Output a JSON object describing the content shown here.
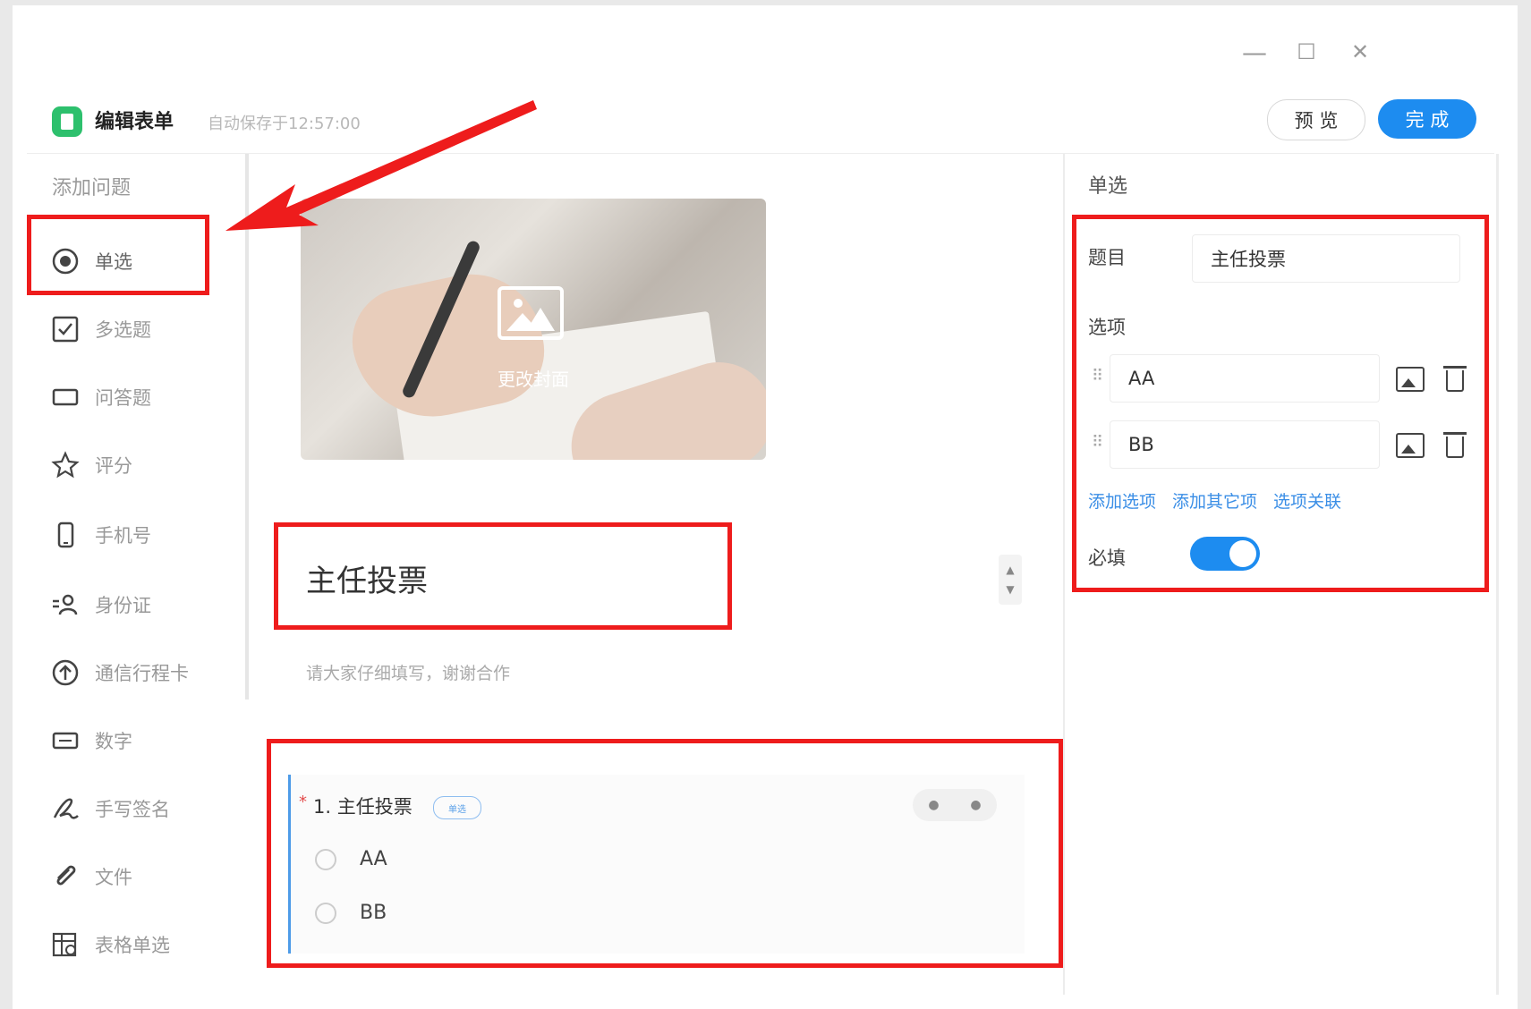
{
  "window": {
    "controls": {
      "minimize": "—",
      "maximize": "☐",
      "close": "✕"
    }
  },
  "header": {
    "title": "编辑表单",
    "autosave": "自动保存于12:57:00",
    "preview_label": "预 览",
    "done_label": "完 成"
  },
  "sidebar": {
    "title": "添加问题",
    "items": [
      {
        "label": "单选",
        "icon": "radio-icon"
      },
      {
        "label": "多选题",
        "icon": "checkbox-icon"
      },
      {
        "label": "问答题",
        "icon": "textbox-icon"
      },
      {
        "label": "评分",
        "icon": "star-icon"
      },
      {
        "label": "手机号",
        "icon": "phone-icon"
      },
      {
        "label": "身份证",
        "icon": "id-card-icon"
      },
      {
        "label": "通信行程卡",
        "icon": "upload-circle-icon"
      },
      {
        "label": "数字",
        "icon": "number-icon"
      },
      {
        "label": "手写签名",
        "icon": "signature-icon"
      },
      {
        "label": "文件",
        "icon": "paperclip-icon"
      },
      {
        "label": "表格单选",
        "icon": "table-radio-icon"
      }
    ]
  },
  "main": {
    "cover_caption": "更改封面",
    "form_title": "主任投票",
    "form_description": "请大家仔细填写，谢谢合作",
    "question": {
      "required_mark": "*",
      "label": "1. 主任投票",
      "type_tag": "单选",
      "options": [
        "AA",
        "BB"
      ]
    }
  },
  "panel": {
    "title": "单选",
    "topic_label": "题目",
    "topic_value": "主任投票",
    "options_label": "选项",
    "options": [
      "AA",
      "BB"
    ],
    "links": [
      "添加选项",
      "添加其它项",
      "选项关联"
    ],
    "required_label": "必填",
    "required_on": true
  },
  "colors": {
    "accent": "#1d8cf0",
    "highlight": "#ee1c1c",
    "logo": "#2dc06d"
  }
}
